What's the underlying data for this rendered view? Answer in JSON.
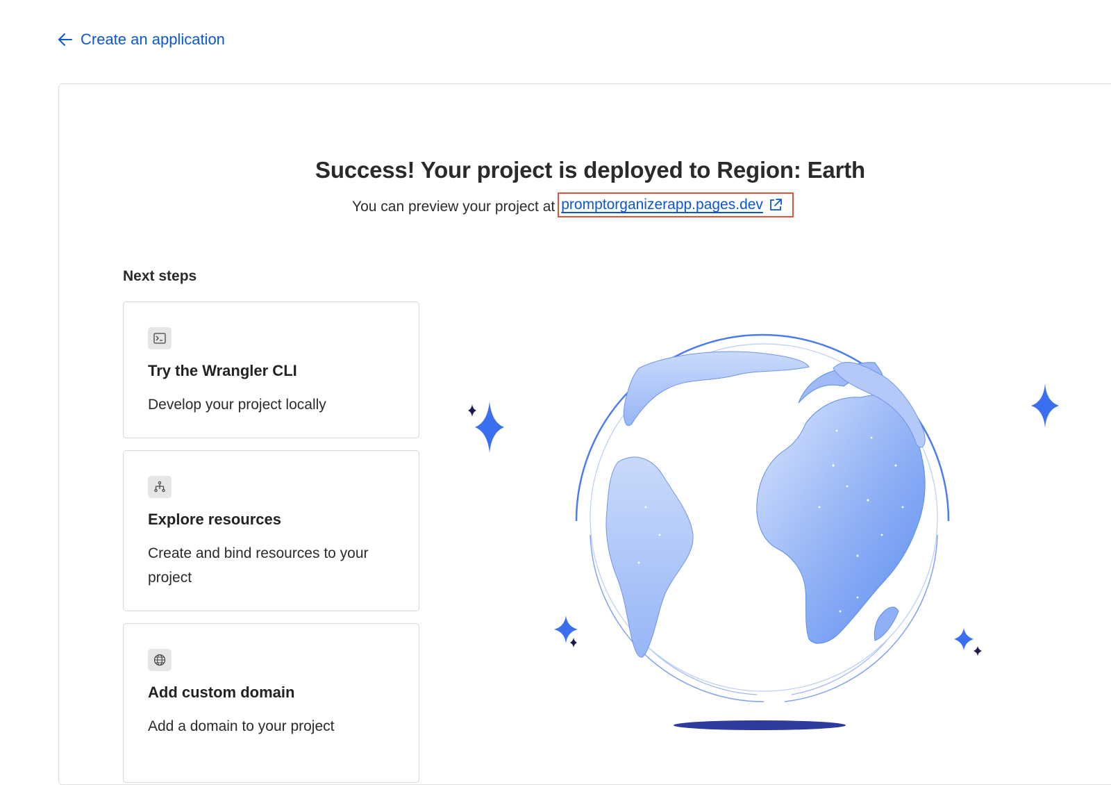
{
  "nav": {
    "back_label": "Create an application"
  },
  "hero": {
    "title": "Success! Your project is deployed to Region: Earth",
    "preview_prefix": "You can preview your project at",
    "preview_url": "promptorganizerapp.pages.dev"
  },
  "next_steps": {
    "heading": "Next steps",
    "items": [
      {
        "icon": "terminal-icon",
        "title": "Try the Wrangler CLI",
        "description": "Develop your project locally"
      },
      {
        "icon": "network-icon",
        "title": "Explore resources",
        "description": "Create and bind resources to your project"
      },
      {
        "icon": "globe-icon",
        "title": "Add custom domain",
        "description": "Add a domain to your project"
      }
    ]
  },
  "colors": {
    "link": "#0b57d0",
    "highlight_border": "#e0533a",
    "globe_blue": "#5b8def",
    "sparkle_blue": "#3a6ff0",
    "sparkle_dark": "#1a1a4e"
  }
}
